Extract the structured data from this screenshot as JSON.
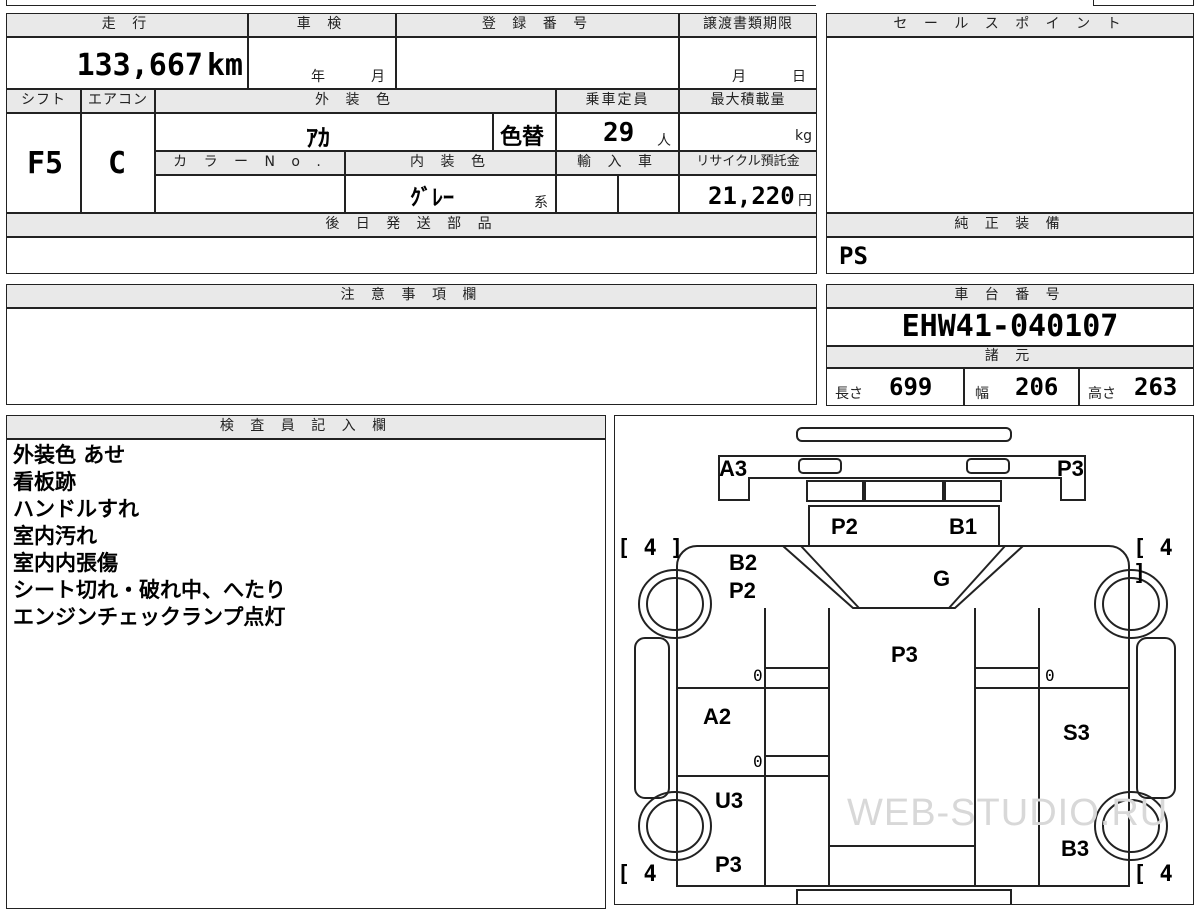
{
  "top_strip_text": "",
  "mileage": {
    "header": "走 行",
    "value": "133,667",
    "unit": "km"
  },
  "shaken": {
    "header": "車 検",
    "year_unit": "年",
    "month_unit": "月"
  },
  "registration": {
    "header": "登 録 番 号",
    "value": ""
  },
  "transfer_deadline": {
    "header": "譲渡書類期限",
    "month_unit": "月",
    "day_unit": "日"
  },
  "shift": {
    "header": "シフト",
    "value": "F5"
  },
  "aircon": {
    "header": "エアコン",
    "value": "C"
  },
  "exterior_color": {
    "header": "外 装 色",
    "value": "ｱｶ",
    "note": "色替"
  },
  "capacity": {
    "header": "乗車定員",
    "value": "29",
    "unit": "人"
  },
  "max_load": {
    "header": "最大積載量",
    "value": "",
    "unit": "kg"
  },
  "color_no": {
    "header": "カ ラ ー N o .",
    "value": ""
  },
  "interior_color": {
    "header": "内 装 色",
    "value": "ｸﾞﾚｰ",
    "suffix": "系"
  },
  "import": {
    "header": "輸 入 車",
    "value": ""
  },
  "recycle": {
    "header": "リサイクル預託金",
    "value": "21,220",
    "unit": "円"
  },
  "later_parts": {
    "header": "後 日 発 送 部 品",
    "value": ""
  },
  "sales_point": {
    "header": "セ ー ル ス ポ イ ン ト",
    "value": ""
  },
  "genuine_equipment": {
    "header": "純 正 装 備",
    "value": "PS"
  },
  "notes": {
    "header": "注 意 事 項 欄",
    "value": ""
  },
  "chassis": {
    "header": "車 台 番 号",
    "value": "EHW41-040107"
  },
  "specs": {
    "header": "諸 元",
    "length_label": "長さ",
    "length": "699",
    "width_label": "幅",
    "width": "206",
    "height_label": "高さ",
    "height": "263"
  },
  "inspector": {
    "header": "検 査 員 記 入 欄",
    "lines": [
      "外装色 あせ",
      "看板跡",
      "ハンドルすれ",
      "室内汚れ",
      "室内内張傷",
      "シート切れ・破れ中、へたり",
      "エンジンチェックランプ点灯"
    ]
  },
  "diagram": {
    "labels": {
      "a3": "A3",
      "p3_top": "P3",
      "p2_front": "P2",
      "b1": "B1",
      "b2": "B2",
      "p2_left": "P2",
      "g": "G",
      "p3_center": "P3",
      "a2": "A2",
      "s3": "S3",
      "u3": "U3",
      "p3_bottom": "P3",
      "b3": "B3",
      "zero": "0"
    },
    "tire_brackets": {
      "tl": "[ 4 ]",
      "tr": "[ 4 ]",
      "bl": "[ 4",
      "br": "[ 4"
    },
    "watermark": "WEB-STUDIO.RU"
  }
}
